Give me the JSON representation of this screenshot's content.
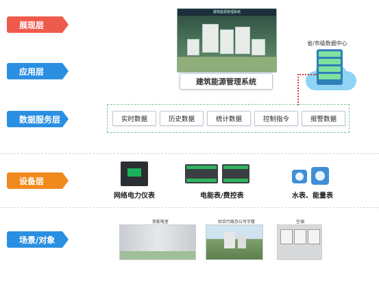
{
  "layers": [
    {
      "label": "展现层",
      "color": "#ee5a4c"
    },
    {
      "label": "应用层",
      "color": "#2a8fe0"
    },
    {
      "label": "数据服务层",
      "color": "#2a8fe0"
    },
    {
      "label": "设备层",
      "color": "#f08a1e"
    },
    {
      "label": "场景/对象",
      "color": "#2a8fe0"
    }
  ],
  "presentation": {
    "screen_title": "建筑能源管理系统",
    "system_name": "建筑能源管理系统"
  },
  "data_center": {
    "label": "省/市级数据中心"
  },
  "data_services": [
    "实时数据",
    "历史数据",
    "统计数据",
    "控制指令",
    "报警数据"
  ],
  "devices": [
    {
      "label": "网络电力仪表",
      "icon": "power-meter-icon"
    },
    {
      "label": "电能表/费控表",
      "icon": "energy-meter-icon"
    },
    {
      "label": "水表、能量表",
      "icon": "water-meter-icon"
    }
  ],
  "scenes": [
    {
      "title": "变配电室",
      "icon": "switchgear-room-image"
    },
    {
      "title": "综合行政办公写字楼",
      "icon": "office-building-image"
    },
    {
      "title": "空调",
      "icon": "air-conditioner-image"
    }
  ]
}
